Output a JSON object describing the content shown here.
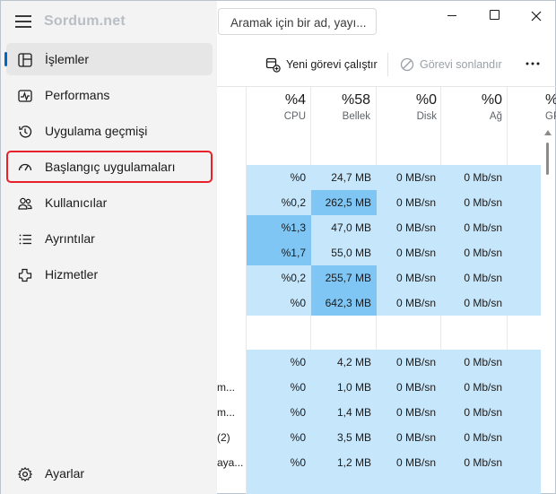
{
  "app": {
    "brand": "Sordum.net"
  },
  "search": {
    "placeholder": "Aramak için bir ad, yayı..."
  },
  "sidebar": {
    "items": [
      {
        "label": "İşlemler",
        "icon": "processes-icon",
        "active": true
      },
      {
        "label": "Performans",
        "icon": "performance-icon"
      },
      {
        "label": "Uygulama geçmişi",
        "icon": "app-history-icon"
      },
      {
        "label": "Başlangıç uygulamaları",
        "icon": "startup-apps-icon",
        "highlighted": true
      },
      {
        "label": "Kullanıcılar",
        "icon": "users-icon"
      },
      {
        "label": "Ayrıntılar",
        "icon": "details-icon"
      },
      {
        "label": "Hizmetler",
        "icon": "services-icon"
      }
    ],
    "settings_label": "Ayarlar"
  },
  "toolbar": {
    "run_new_task": "Yeni görevi çalıştır",
    "end_task": "Görevi sonlandır"
  },
  "columns": [
    {
      "pct": "%4",
      "name": "CPU"
    },
    {
      "pct": "%58",
      "name": "Bellek"
    },
    {
      "pct": "%0",
      "name": "Disk"
    },
    {
      "pct": "%0",
      "name": "Ağ"
    },
    {
      "pct": "%",
      "name": "GP"
    }
  ],
  "rows": [
    {
      "name": "",
      "cpu": "%0",
      "mem": "24,7 MB",
      "disk": "0 MB/sn",
      "net": "0 Mb/sn"
    },
    {
      "name": "",
      "cpu": "%0,2",
      "mem": "262,5 MB",
      "disk": "0 MB/sn",
      "net": "0 Mb/sn"
    },
    {
      "name": "",
      "cpu": "%1,3",
      "mem": "47,0 MB",
      "disk": "0 MB/sn",
      "net": "0 Mb/sn"
    },
    {
      "name": "",
      "cpu": "%1,7",
      "mem": "55,0 MB",
      "disk": "0 MB/sn",
      "net": "0 Mb/sn"
    },
    {
      "name": "",
      "cpu": "%0,2",
      "mem": "255,7 MB",
      "disk": "0 MB/sn",
      "net": "0 Mb/sn"
    },
    {
      "name": "",
      "cpu": "%0",
      "mem": "642,3 MB",
      "disk": "0 MB/sn",
      "net": "0 Mb/sn"
    },
    {
      "name": "",
      "cpu": "%0",
      "mem": "4,2 MB",
      "disk": "0 MB/sn",
      "net": "0 Mb/sn"
    },
    {
      "name": "m...",
      "cpu": "%0",
      "mem": "1,0 MB",
      "disk": "0 MB/sn",
      "net": "0 Mb/sn"
    },
    {
      "name": "m...",
      "cpu": "%0",
      "mem": "1,4 MB",
      "disk": "0 MB/sn",
      "net": "0 Mb/sn"
    },
    {
      "name": "(2)",
      "cpu": "%0",
      "mem": "3,5 MB",
      "disk": "0 MB/sn",
      "net": "0 Mb/sn"
    },
    {
      "name": "aya...",
      "cpu": "%0",
      "mem": "1,2 MB",
      "disk": "0 MB/sn",
      "net": "0 Mb/sn"
    }
  ],
  "colors": {
    "accent": "#0067c0",
    "highlight_border": "#e8202a",
    "heat_light": "#c6e6fb",
    "heat_mid": "#a8d8fa",
    "heat_strong": "#7fc6f5"
  }
}
